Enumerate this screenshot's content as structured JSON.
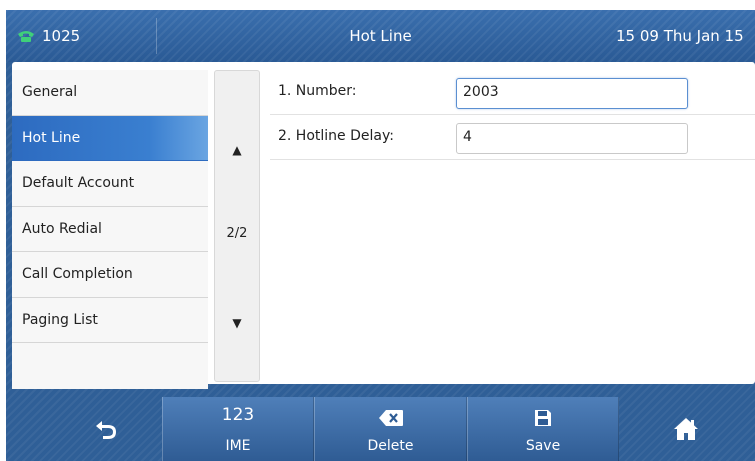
{
  "status_bar": {
    "account": "1025",
    "title": "Hot Line",
    "datetime": "15 09 Thu Jan 15"
  },
  "menu": {
    "items": [
      {
        "label": "General"
      },
      {
        "label": "Hot Line"
      },
      {
        "label": "Default Account"
      },
      {
        "label": "Auto Redial"
      },
      {
        "label": "Call Completion"
      },
      {
        "label": "Paging List"
      }
    ],
    "active_index": 1
  },
  "pager": {
    "page": "2/2",
    "up": "▲",
    "down": "▼"
  },
  "settings": [
    {
      "label": "1. Number:",
      "value": "2003"
    },
    {
      "label": "2. Hotline Delay:",
      "value": "4"
    }
  ],
  "softkeys": {
    "ime_top": "123",
    "ime_label": "IME",
    "delete_label": "Delete",
    "save_label": "Save"
  },
  "colors": {
    "accent": "#2f5f97",
    "active_item": "#2d6bc0",
    "phone_icon": "#3fd07a"
  },
  "icons": {
    "account": "phone-icon",
    "back": "back-arrow-icon",
    "delete": "backspace-icon",
    "save": "floppy-disk-icon",
    "home": "home-icon"
  }
}
